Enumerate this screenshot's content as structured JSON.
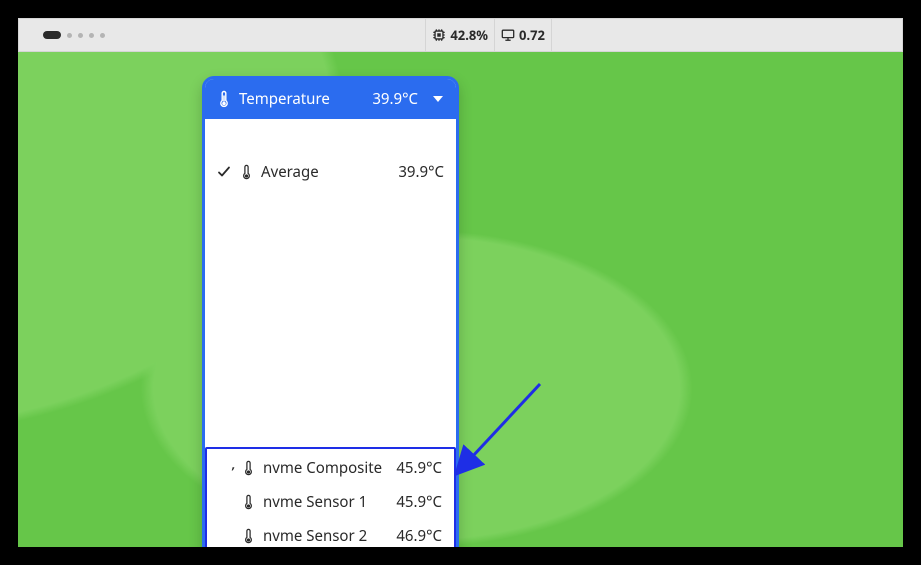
{
  "topbar": {
    "cpu": "42.8%",
    "load": "0.72"
  },
  "panel": {
    "header": {
      "title": "Temperature",
      "value": "39.9°C"
    },
    "top_items": [
      {
        "label": "Average",
        "value": "39.9°C",
        "checked": true
      }
    ],
    "bottom_items": [
      {
        "label": "nvme Composite",
        "value": "45.9°C"
      },
      {
        "label": "nvme Sensor 1",
        "value": "45.9°C"
      },
      {
        "label": "nvme Sensor 2",
        "value": "46.9°C"
      }
    ]
  }
}
